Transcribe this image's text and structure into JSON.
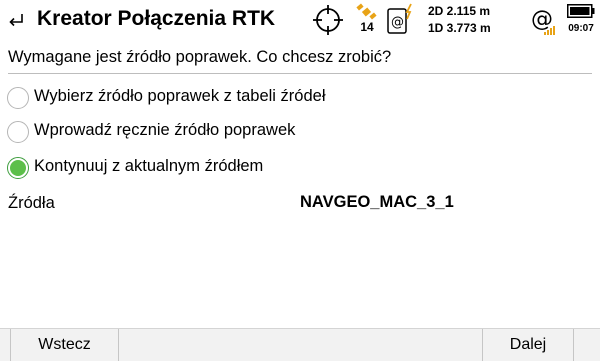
{
  "header": {
    "title": "Kreator Połączenia RTK",
    "satellite_count": "14",
    "precision_2d": "2D 2.115 m",
    "precision_1d": "1D 3.773 m",
    "time": "09:07",
    "accent_color": "#e8a317"
  },
  "content": {
    "question": "Wymagane jest źródło poprawek. Co chcesz zrobić?",
    "options": [
      {
        "label": "Wybierz źródło poprawek z tabeli źródeł",
        "checked": false
      },
      {
        "label": "Wprowadź ręcznie źródło poprawek",
        "checked": false
      },
      {
        "label": "Kontynuuj z aktualnym źródłem",
        "checked": true
      }
    ],
    "source_label": "Źródła",
    "source_value": "NAVGEO_MAC_3_1"
  },
  "footer": {
    "back_label": "Wstecz",
    "next_label": "Dalej"
  },
  "icons": {
    "back": "back-arrow-icon",
    "crosshair": "crosshair-icon",
    "satellite": "satellite-icon",
    "device": "device-link-icon",
    "internet": "at-signal-icon",
    "battery": "battery-icon"
  }
}
